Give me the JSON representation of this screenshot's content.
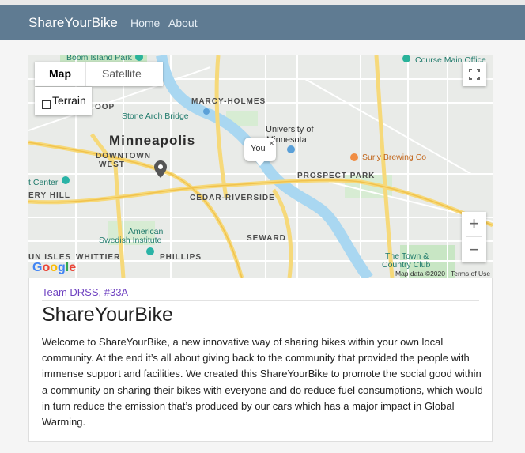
{
  "navbar": {
    "brand": "ShareYourBike",
    "links": [
      "Home",
      "About"
    ]
  },
  "map": {
    "type_buttons": [
      "Map",
      "Satellite"
    ],
    "active_type": "Map",
    "terrain_label": "Terrain",
    "terrain_checked": false,
    "popup_text": "You",
    "popup_close": "×",
    "zoom_in": "+",
    "zoom_out": "−",
    "labels": {
      "city": "Minneapolis",
      "marcy_holmes": "MARCY-HOLMES",
      "downtown": "DOWNTOWN",
      "west": "WEST",
      "prospect_park": "PROSPECT PARK",
      "cedar_riverside": "CEDAR-RIVERSIDE",
      "seward": "SEWARD",
      "phillips": "PHILLIPS",
      "whittier": "WHITTIER",
      "un_isles": "UN ISLES",
      "ery_hill": "ERY HILL",
      "stone_arch": "Stone Arch Bridge",
      "univ1": "University of",
      "univ2": "Minnesota",
      "american": "American",
      "swedish": "Swedish Institute",
      "surly": "Surly Brewing Co",
      "course_main": "Course Main Office",
      "boom_island": "Boom Island Park",
      "town_country1": "The Town &",
      "town_country2": "Country Club",
      "t_center": "t Center",
      "oop": "OOP",
      "map_data": "Map data ©2020",
      "terms": "Terms of Use",
      "google": "Google"
    },
    "colors": {
      "water": "#a9d7f1",
      "highway": "#f6d97a",
      "road": "#ffffff",
      "park": "#c8e6c4",
      "land": "#e9ebe8"
    }
  },
  "card": {
    "team": "Team DRSS, #33A",
    "title": "ShareYourBike",
    "body": "Welcome to ShareYourBike, a new innovative way of sharing bikes within your own local community. At the end it’s all about giving back to the community that provided the people with immense support and facilities. We created this ShareYourBike to promote the social good within a community on sharing their bikes with everyone and do reduce fuel consumptions, which would in turn reduce the emission that’s produced by our cars which has a major impact in Global Warming."
  }
}
